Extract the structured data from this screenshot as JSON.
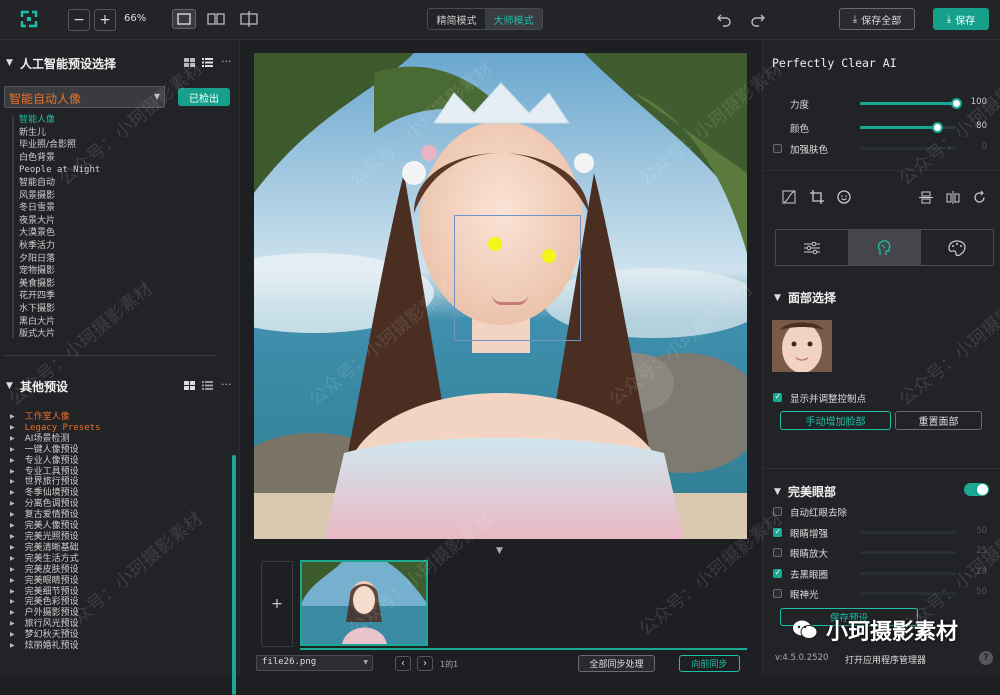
{
  "topbar": {
    "zoom": "66%",
    "mode_tabs": [
      "精简模式",
      "大师模式"
    ],
    "save_all": "保存全部",
    "save": "保存"
  },
  "left": {
    "ai_title": "人工智能预设选择",
    "preset_select": "智能自动人像",
    "detected": "已检出",
    "ai_presets": [
      "智能人像",
      "新生儿",
      "毕业照/合影照",
      "白色背景",
      "People at Night",
      "智能自动",
      "风景摄影",
      "冬日雪景",
      "夜景大片",
      "大漠景色",
      "秋季活力",
      "夕阳日落",
      "宠物摄影",
      "美食摄影",
      "花开四季",
      "水下摄影",
      "黑白大片",
      "版式大片"
    ],
    "other_title": "其他预设",
    "other_presets": [
      "工作室人像",
      "Legacy Presets",
      "AI场景检测",
      "一键人像预设",
      "专业人像预设",
      "专业工具预设",
      "世界旅行预设",
      "冬季仙境预设",
      "分离色调预设",
      "复古爱情预设",
      "完美人像预设",
      "完美光照预设",
      "完美清晰基础",
      "完美生活方式",
      "完美皮肤预设",
      "完美眼睛预设",
      "完美细节预设",
      "完美色彩预设",
      "户外摄影预设",
      "旅行风光预设",
      "梦幻秋天预设",
      "炫丽婚礼预设"
    ]
  },
  "bottom": {
    "filename": "file26.png",
    "page": "1的1",
    "sync_all": "全部同步处理",
    "sync_forward": "向前同步"
  },
  "right": {
    "product": "Perfectly Clear AI",
    "sliders_top": [
      {
        "label": "力度",
        "value": "100",
        "fraction": 1.0,
        "checkbox": false
      },
      {
        "label": "颜色",
        "value": "80",
        "fraction": 0.8,
        "checkbox": false
      },
      {
        "label": "加强肤色",
        "value": "0",
        "fraction": 0.0,
        "checkbox": true
      }
    ],
    "face_section": "面部选择",
    "show_points": "显示并调整控制点",
    "add_face": "手动增加脸部",
    "reset_face": "重置面部",
    "eye_section": "完美眼部",
    "eye_rows": [
      {
        "label": "自动红眼去除",
        "checked": false,
        "slider": false,
        "value": ""
      },
      {
        "label": "眼睛增强",
        "checked": true,
        "slider": true,
        "value": "50",
        "fraction": 0.5
      },
      {
        "label": "眼睛放大",
        "checked": false,
        "slider": true,
        "value": "25",
        "fraction": 0.25
      },
      {
        "label": "去黑眼圈",
        "checked": true,
        "slider": true,
        "value": "28",
        "fraction": 0.28
      },
      {
        "label": "眼神光",
        "checked": false,
        "slider": true,
        "value": "50",
        "fraction": 0.5
      }
    ],
    "save_preset": "保存预设",
    "version": "v:4.5.0.2520",
    "open_manager": "打开应用程序管理器",
    "help": "?"
  },
  "watermark": {
    "brand": "小珂摄影素材",
    "tiles": [
      "公众号：小珂摄影素材"
    ]
  },
  "colors": {
    "accent": "#1aa893",
    "bg": "#1e1f22",
    "panel": "#222327"
  }
}
